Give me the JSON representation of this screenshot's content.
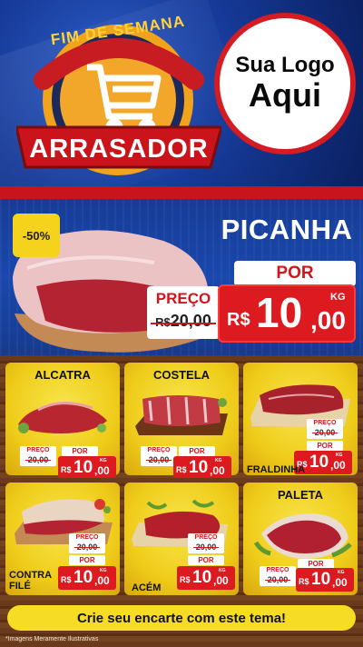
{
  "header": {
    "emblem_top": "FIM DE SEMANA",
    "emblem_bottom": "ARRASADOR",
    "logo_line1": "Sua Logo",
    "logo_line2": "Aqui"
  },
  "hero": {
    "discount": "-50%",
    "product": "PICANHA",
    "por_label": "POR",
    "preco_label": "PREÇO",
    "old_currency": "R$",
    "old_price": "20,00",
    "currency": "R$",
    "price_int": "10",
    "price_dec": ",00",
    "unit": "KG"
  },
  "labels": {
    "preco": "PREÇO",
    "por": "POR",
    "currency": "R$",
    "old_price": "20,00",
    "price_int": "10",
    "price_dec": ",00",
    "unit": "KG"
  },
  "cards": [
    {
      "name": "ALCATRA"
    },
    {
      "name": "COSTELA"
    },
    {
      "name": "FRALDINHA"
    },
    {
      "name_line1": "CONTRA",
      "name_line2": "FILÉ"
    },
    {
      "name": "ACÉM"
    },
    {
      "name": "PALETA"
    }
  ],
  "footer": {
    "cta": "Crie seu encarte com este tema!",
    "note": "*Imagens Meramente Ilustrativas"
  },
  "colors": {
    "brand_red": "#dc1a20",
    "brand_yellow": "#f7dc26",
    "brand_blue": "#1a48ad"
  }
}
